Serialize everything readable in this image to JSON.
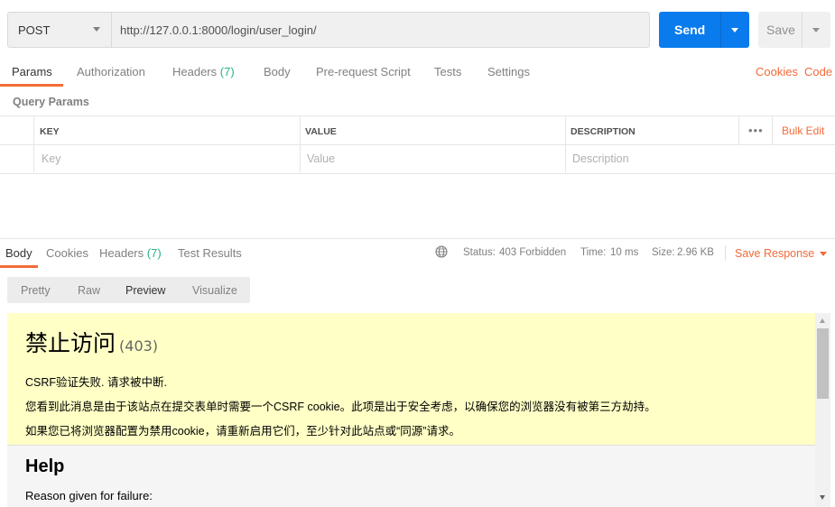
{
  "request": {
    "method": "POST",
    "url": "http://127.0.0.1:8000/login/user_login/",
    "send_label": "Send",
    "save_label": "Save"
  },
  "tabs": [
    {
      "label": "Params"
    },
    {
      "label": "Authorization"
    },
    {
      "label": "Headers",
      "count": "(7)"
    },
    {
      "label": "Body"
    },
    {
      "label": "Pre-request Script"
    },
    {
      "label": "Tests"
    },
    {
      "label": "Settings"
    }
  ],
  "links": {
    "cookies": "Cookies",
    "code": "Code"
  },
  "query_params": {
    "title": "Query Params",
    "headers": {
      "key": "KEY",
      "value": "VALUE",
      "description": "DESCRIPTION"
    },
    "placeholders": {
      "key": "Key",
      "value": "Value",
      "description": "Description"
    },
    "more": "•••",
    "bulk_edit": "Bulk Edit"
  },
  "response": {
    "tabs": [
      {
        "label": "Body"
      },
      {
        "label": "Cookies"
      },
      {
        "label": "Headers",
        "count": "(7)"
      },
      {
        "label": "Test Results"
      }
    ],
    "status_label": "Status:",
    "status_value": "403 Forbidden",
    "time_label": "Time:",
    "time_value": "10 ms",
    "size_label": "Size:",
    "size_value": "2.96 KB",
    "save_response": "Save Response",
    "formats": [
      "Pretty",
      "Raw",
      "Preview",
      "Visualize"
    ],
    "selected_format": "Preview"
  },
  "preview": {
    "heading": "禁止访问",
    "code": "(403)",
    "line1": "CSRF验证失败. 请求被中断.",
    "line2": "您看到此消息是由于该站点在提交表单时需要一个CSRF cookie。此项是出于安全考虑，以确保您的浏览器没有被第三方劫持。",
    "line3": "如果您已将浏览器配置为禁用cookie，请重新启用它们，至少针对此站点或“同源”请求。",
    "help_title": "Help",
    "reason": "Reason given for failure:"
  },
  "colors": {
    "accent": "#f26b3a",
    "send": "#097bed",
    "success": "#26b47f",
    "preview_bg": "#ffffc6"
  }
}
